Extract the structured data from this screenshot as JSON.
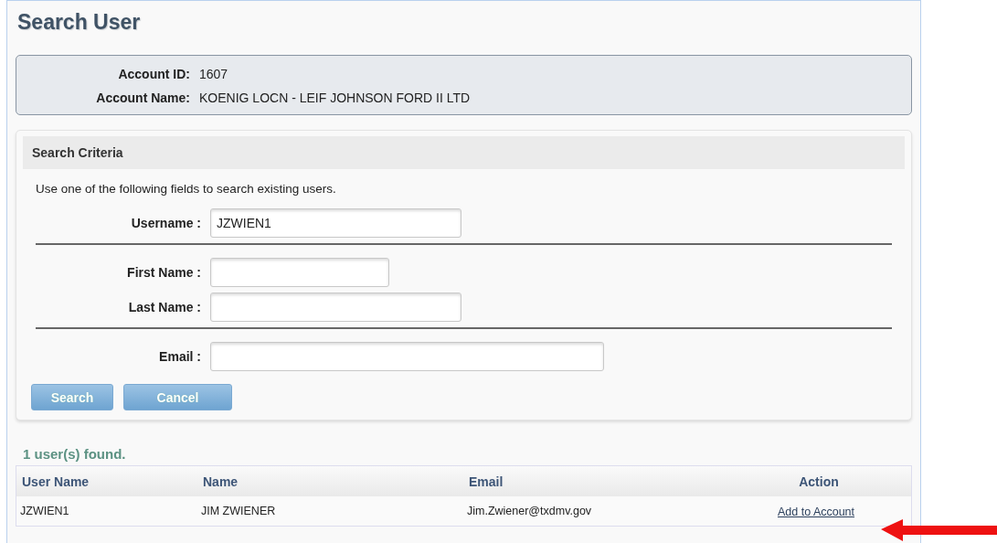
{
  "title": "Search User",
  "account": [
    {
      "label": "Account ID:",
      "value": "1607"
    },
    {
      "label": "Account Name:",
      "value": "KOENIG LOCN - LEIF JOHNSON FORD II LTD"
    }
  ],
  "search_criteria": {
    "title": "Search Criteria",
    "instructions": "Use one of the following fields to search existing users.",
    "groups": [
      [
        {
          "label": "Username :",
          "value": "JZWIEN1"
        }
      ],
      [
        {
          "label": "First Name :"
        },
        {
          "label": "Last Name :"
        }
      ],
      [
        {
          "label": "Email :"
        }
      ]
    ],
    "buttons": [
      "Search",
      "Cancel"
    ]
  },
  "results": {
    "summary": "1 user(s) found.",
    "columns": [
      "User Name",
      "Name",
      "Email",
      "Action"
    ],
    "rows": [
      {
        "cells": [
          "JZWIEN1",
          "JIM ZWIENER",
          "Jim.Zwiener@txdmv.gov"
        ],
        "action": "Add to Account"
      }
    ]
  }
}
